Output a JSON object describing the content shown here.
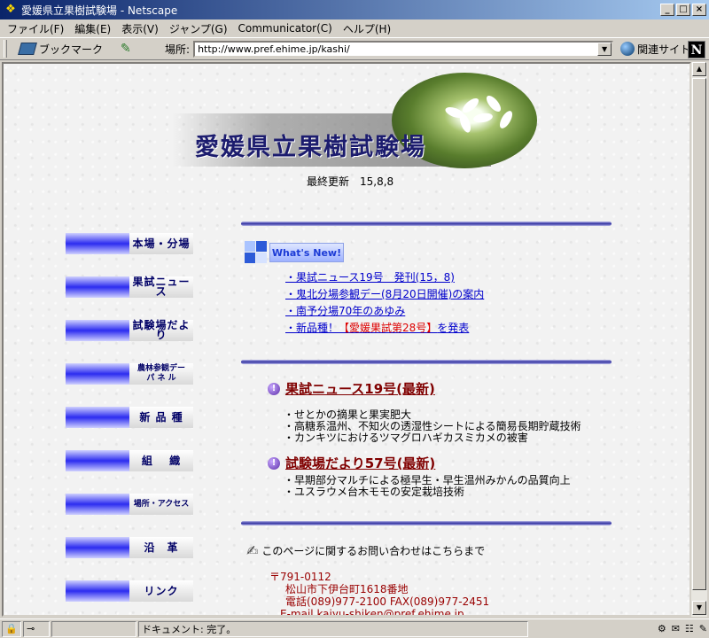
{
  "window": {
    "title": "愛媛県立果樹試験場 - Netscape",
    "buttons": [
      "_",
      "□",
      "×"
    ]
  },
  "menu": [
    "ファイル(F)",
    "編集(E)",
    "表示(V)",
    "ジャンプ(G)",
    "Communicator(C)",
    "ヘルプ(H)"
  ],
  "toolbar": {
    "bookmark_label": "ブックマーク",
    "location_label": "場所:",
    "url": "http://www.pref.ehime.jp/kashi/",
    "related_label": "関連サイト"
  },
  "page": {
    "site_title": "愛媛県立果樹試験場",
    "updated": "最終更新　15,8,8",
    "nav": [
      "本場・分場",
      "果試ニュース",
      "試験場だより",
      "農林参観デー\nパ ネ ル",
      "新 品 種",
      "組　 織",
      "場所・アクセス",
      "沿　革",
      "リンク"
    ],
    "whats_new_label": "What's New!",
    "news": [
      {
        "text": "・果試ニュース19号　発刊(15，8)"
      },
      {
        "text": "・鬼北分場参観デー(8月20日開催)の案内"
      },
      {
        "text": "・南予分場70年のあゆみ"
      },
      {
        "prefix": "・新品種！",
        "highlight": "【愛媛果試第28号】",
        "suffix": "を発表"
      }
    ],
    "section1": {
      "title": "果試ニュース19号(最新)",
      "items": [
        "・せとかの摘果と果実肥大",
        "・高糖系温州、不知火の透湿性シートによる簡易長期貯蔵技術",
        "・カンキツにおけるツマグロハギカスミカメの被害"
      ]
    },
    "section2": {
      "title": "試験場だより57号(最新)",
      "items": [
        "・早期部分マルチによる極早生・早生温州みかんの品質向上",
        "・ユスラウメ台木モモの安定栽培技術"
      ]
    },
    "contact": {
      "heading": "このページに関するお問い合わせはこちらまで",
      "postal": "〒791-0112",
      "address": "松山市下伊台町1618番地",
      "phone": "電話(089)977-2100 FAX(089)977-2451",
      "email": "E-mail  kajyu-shiken@pref.ehime.jp"
    }
  },
  "status": {
    "text": "ドキュメント: 完了。"
  }
}
